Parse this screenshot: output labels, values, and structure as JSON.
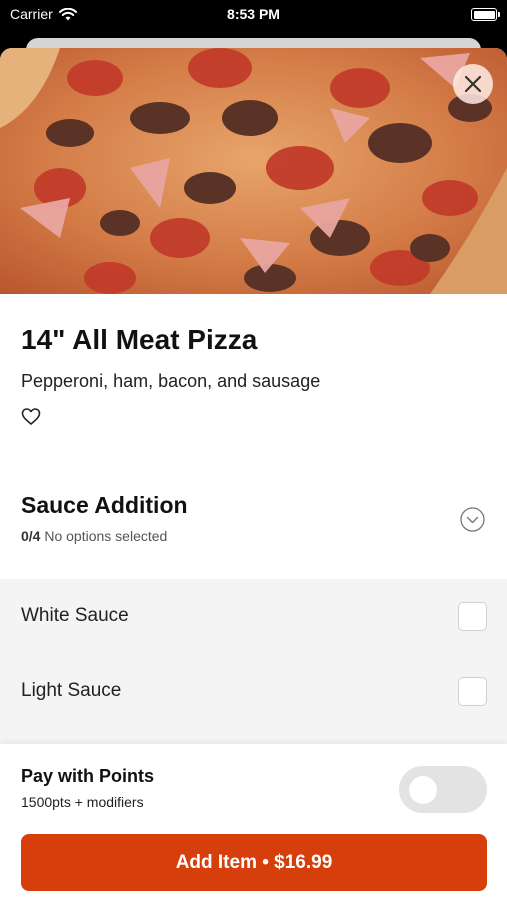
{
  "status_bar": {
    "carrier": "Carrier",
    "time": "8:53 PM"
  },
  "item": {
    "title": "14\" All Meat Pizza",
    "description": "Pepperoni, ham, bacon, and sausage",
    "image_icon": "pizza-photo"
  },
  "section": {
    "title": "Sauce Addition",
    "count": "0/4",
    "status": "No options selected",
    "options": [
      {
        "label": "White Sauce",
        "checked": false
      },
      {
        "label": "Light Sauce",
        "checked": false
      }
    ]
  },
  "points": {
    "title": "Pay with Points",
    "subtitle": "1500pts + modifiers",
    "enabled": false
  },
  "cta": {
    "label": "Add Item • $16.99"
  },
  "colors": {
    "accent": "#d63e0c",
    "toggle_off": "#e3e3e3",
    "options_bg": "#f4f4f4"
  }
}
